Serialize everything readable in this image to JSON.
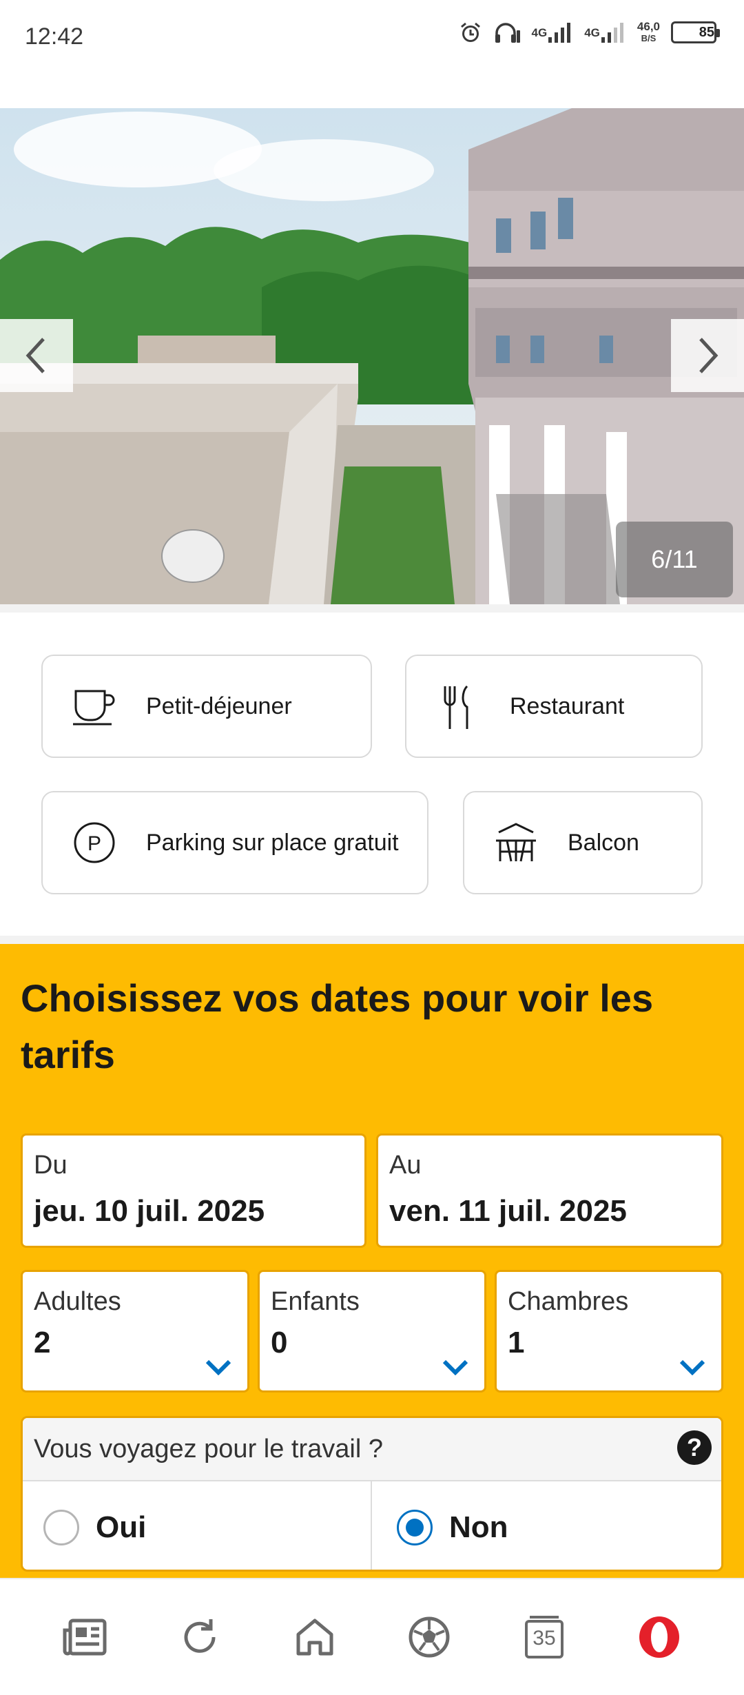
{
  "status_bar": {
    "time": "12:42",
    "net1": "4G",
    "net2": "4G",
    "speed_value": "46,0",
    "speed_unit": "B/S",
    "battery": "85",
    "battery_level": 0.85,
    "icons": [
      "alarm-icon",
      "headset-icon",
      "signal-icon",
      "signal-icon"
    ]
  },
  "gallery": {
    "counter": "6/11",
    "prev_icon": "chevron-left-icon",
    "next_icon": "chevron-right-icon"
  },
  "amenities": [
    {
      "label": "Petit-déjeuner",
      "icon": "coffee-cup-icon"
    },
    {
      "label": "Restaurant",
      "icon": "fork-knife-icon"
    },
    {
      "label": "Parking sur place gratuit",
      "icon": "parking-icon"
    },
    {
      "label": "Balcon",
      "icon": "balcony-icon"
    }
  ],
  "booking": {
    "title": "Choisissez vos dates pour voir les tarifs",
    "checkin": {
      "label": "Du",
      "value": "jeu. 10 juil. 2025"
    },
    "checkout": {
      "label": "Au",
      "value": "ven. 11 juil. 2025"
    },
    "adults": {
      "label": "Adultes",
      "value": "2"
    },
    "children": {
      "label": "Enfants",
      "value": "0"
    },
    "rooms": {
      "label": "Chambres",
      "value": "1"
    },
    "business": {
      "question": "Vous voyagez pour le travail ?",
      "help": "?",
      "yes": "Oui",
      "no": "Non",
      "selected": "Non"
    },
    "colors": {
      "panel": "#febb02",
      "accent": "#0071c2"
    }
  },
  "bottom_nav": {
    "tabs_count": "35",
    "icons": [
      "news-icon",
      "reload-icon",
      "home-icon",
      "football-icon",
      "tabs-icon",
      "opera-icon"
    ]
  }
}
